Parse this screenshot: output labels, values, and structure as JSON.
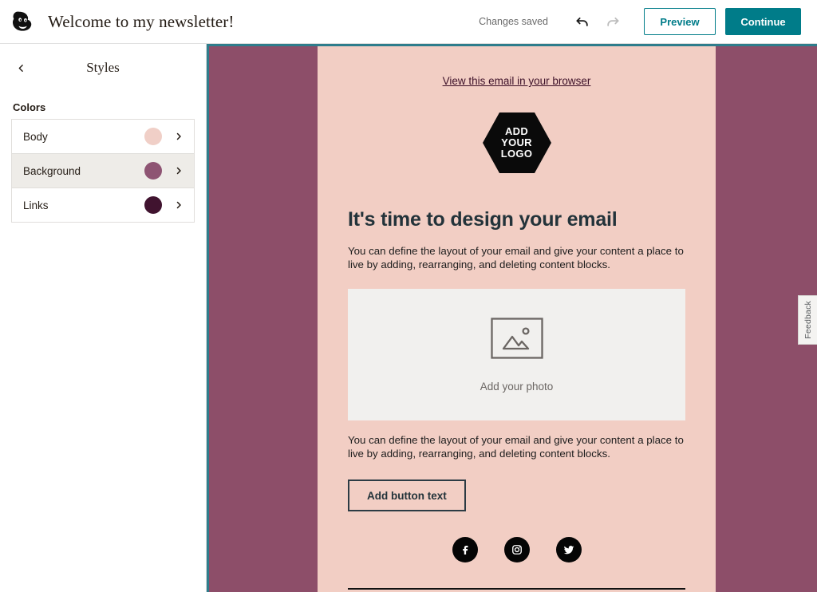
{
  "topbar": {
    "logo_icon": "mailchimp-freddie-logo",
    "title": "Welcome to my newsletter!",
    "saved_status": "Changes saved",
    "undo_icon": "undo-arrow-icon",
    "redo_icon": "redo-arrow-icon",
    "preview_label": "Preview",
    "continue_label": "Continue",
    "accent_color": "#007c89"
  },
  "sidebar": {
    "back_icon": "chevron-left-icon",
    "title": "Styles",
    "section_label": "Colors",
    "rows": [
      {
        "label": "Body",
        "swatch": "#f0cfc7",
        "selected": false,
        "chevron": "chevron-right-icon"
      },
      {
        "label": "Background",
        "swatch": "#8e5473",
        "selected": true,
        "chevron": "chevron-right-icon"
      },
      {
        "label": "Links",
        "swatch": "#40132f",
        "selected": false,
        "chevron": "chevron-right-icon"
      }
    ]
  },
  "canvas": {
    "outer_background_color": "#8d4e69",
    "border_color": "#2e7d8c",
    "email_background_color": "#f2cec4"
  },
  "email": {
    "preheader_link": "View this email in your browser",
    "logo_line1": "ADD",
    "logo_line2": "YOUR",
    "logo_line3": "LOGO",
    "heading": "It's time to design your email",
    "paragraph1": "You can define the layout of your email and give your content a place to live by adding, rearranging, and deleting content blocks.",
    "photo_icon": "image-placeholder-icon",
    "photo_caption": "Add your photo",
    "paragraph2": "You can define the layout of your email and give your content a place to live by adding, rearranging, and deleting content blocks.",
    "button_label": "Add button text",
    "social": [
      {
        "name": "facebook-icon"
      },
      {
        "name": "instagram-icon"
      },
      {
        "name": "twitter-icon"
      }
    ]
  },
  "feedback": {
    "label": "Feedback"
  }
}
